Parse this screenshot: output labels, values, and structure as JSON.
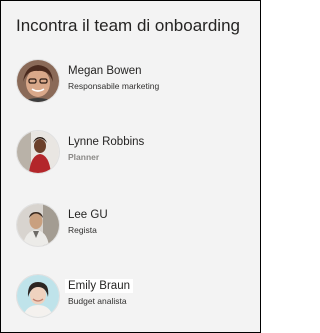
{
  "title": "Incontra il team di onboarding",
  "people": [
    {
      "name": "Megan Bowen",
      "role": "Responsabile marketing"
    },
    {
      "name": "Lynne Robbins",
      "role": "Planner"
    },
    {
      "name": "Lee GU",
      "role": "Regista"
    },
    {
      "name": "Emily Braun",
      "role": "Budget analista"
    }
  ]
}
